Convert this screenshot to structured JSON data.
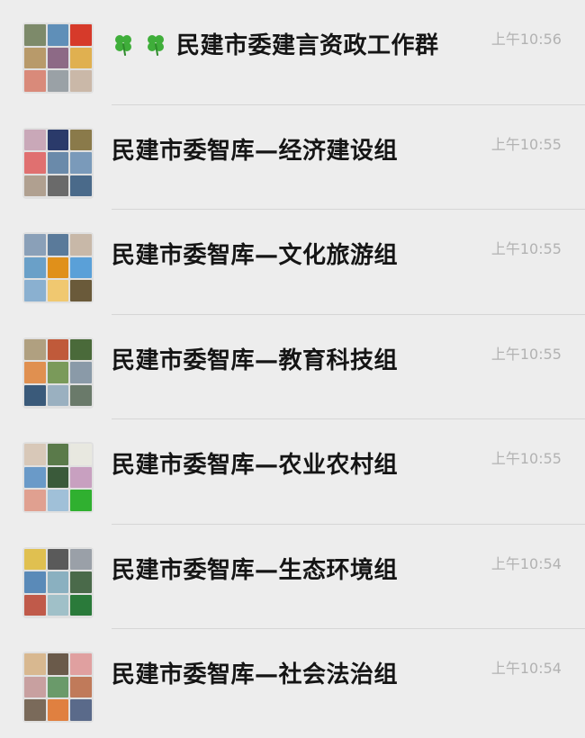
{
  "chats": [
    {
      "title": "民建市委建言资政工作群",
      "time": "上午10:56",
      "title_icons": [
        "clover-icon",
        "clover-icon"
      ],
      "avatar_colors": [
        "#7d8a6a",
        "#5f8fb8",
        "#d63a2a",
        "#b89a6a",
        "#8d6a86",
        "#e0b050",
        "#d98a7a",
        "#9aa1a6",
        "#cab8a8"
      ]
    },
    {
      "title": "民建市委智库—经济建设组",
      "time": "上午10:55",
      "avatar_colors": [
        "#c9a8b8",
        "#2a3a6a",
        "#8a7a4a",
        "#e07070",
        "#6a8aaa",
        "#7a9aba",
        "#b0a090",
        "#6a6a6a",
        "#4a6a8a"
      ]
    },
    {
      "title": "民建市委智库—文化旅游组",
      "time": "上午10:55",
      "avatar_colors": [
        "#8aa0b8",
        "#5a7a9a",
        "#c8b8a8",
        "#6aa0c8",
        "#e0901a",
        "#5aa0d8",
        "#8ab0d0",
        "#f0c870",
        "#6a5a3a"
      ]
    },
    {
      "title": "民建市委智库—教育科技组",
      "time": "上午10:55",
      "avatar_colors": [
        "#b0a080",
        "#c05a3a",
        "#4a6a3a",
        "#e09050",
        "#7a9a5a",
        "#8a9aa8",
        "#3a5a7a",
        "#9ab0c0",
        "#6a7a6a"
      ]
    },
    {
      "title": "民建市委智库—农业农村组",
      "time": "上午10:55",
      "avatar_colors": [
        "#d8c8b8",
        "#5a7a4a",
        "#e8e8e0",
        "#6a9ac8",
        "#3a5a3a",
        "#c8a0c0",
        "#e0a090",
        "#a0c0d8",
        "#30b030"
      ]
    },
    {
      "title": "民建市委智库—生态环境组",
      "time": "上午10:54",
      "avatar_colors": [
        "#e0c050",
        "#5a5a5a",
        "#9aa0a8",
        "#5a8ab8",
        "#8ab0c0",
        "#4a6a4a",
        "#c05a4a",
        "#a0c0c8",
        "#2a7a3a"
      ]
    },
    {
      "title": "民建市委智库—社会法治组",
      "time": "上午10:54",
      "avatar_colors": [
        "#d8b890",
        "#6a5a4a",
        "#e0a0a0",
        "#c8a0a0",
        "#6a9a6a",
        "#c07a5a",
        "#7a6a5a",
        "#e08040",
        "#5a6a8a"
      ]
    }
  ]
}
